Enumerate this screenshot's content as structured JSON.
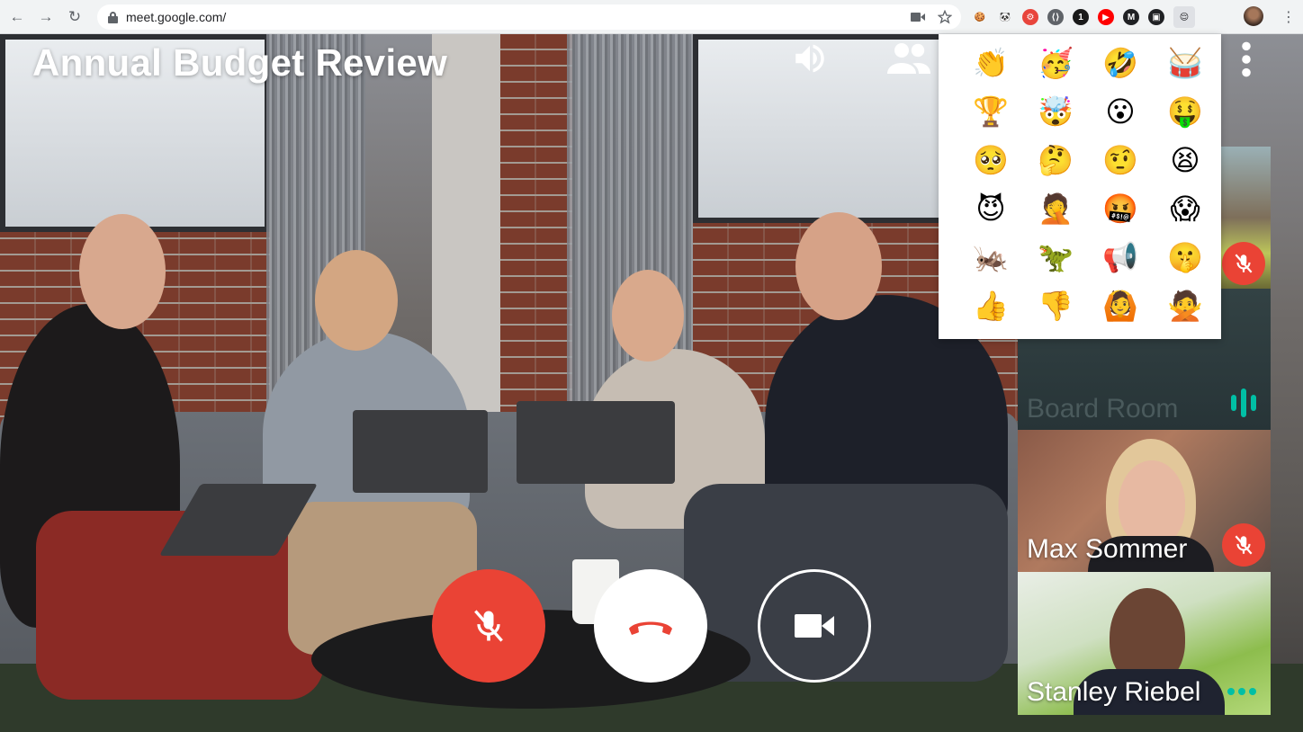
{
  "browser": {
    "url": "meet.google.com/",
    "nav": {
      "back": "←",
      "forward": "→",
      "reload": "↻"
    },
    "extensions": [
      {
        "icon": "cookie-icon",
        "glyph": "🍪",
        "color": "#f1f3f4"
      },
      {
        "icon": "panda-icon",
        "glyph": "🐼",
        "color": "#f1f3f4"
      },
      {
        "icon": "nodes-icon",
        "glyph": "⚙",
        "color": "#e8453c"
      },
      {
        "icon": "code-brackets-icon",
        "glyph": "⟨⟩",
        "color": "#5f6368"
      },
      {
        "icon": "onepassword-icon",
        "glyph": "1",
        "color": "#1a1a1a"
      },
      {
        "icon": "youtube-icon",
        "glyph": "▶",
        "color": "#ff0000"
      },
      {
        "icon": "m-icon",
        "glyph": "M",
        "color": "#202124"
      },
      {
        "icon": "dark-square-icon",
        "glyph": "▣",
        "color": "#202124"
      },
      {
        "icon": "emoji-extension-icon",
        "glyph": "😌",
        "color": "#dfe1e5"
      }
    ]
  },
  "meeting": {
    "title": "Annual Budget Review"
  },
  "emoji_picker": {
    "emojis": [
      {
        "glyph": "👏",
        "name": "clap"
      },
      {
        "glyph": "🥳",
        "name": "party-face"
      },
      {
        "glyph": "🤣",
        "name": "rofl"
      },
      {
        "glyph": "🥁",
        "name": "drum"
      },
      {
        "glyph": "🏆",
        "name": "trophy"
      },
      {
        "glyph": "🤯",
        "name": "mind-blown"
      },
      {
        "glyph": "😮",
        "name": "surprised"
      },
      {
        "glyph": "🤑",
        "name": "money-face"
      },
      {
        "glyph": "🥺",
        "name": "pleading"
      },
      {
        "glyph": "🤔",
        "name": "thinking"
      },
      {
        "glyph": "🤨",
        "name": "raised-eyebrow"
      },
      {
        "glyph": "😫",
        "name": "tired"
      },
      {
        "glyph": "😈",
        "name": "devil"
      },
      {
        "glyph": "🤦",
        "name": "facepalm"
      },
      {
        "glyph": "🤬",
        "name": "cursing"
      },
      {
        "glyph": "😱",
        "name": "scream"
      },
      {
        "glyph": "🦗",
        "name": "cricket"
      },
      {
        "glyph": "🦖",
        "name": "t-rex"
      },
      {
        "glyph": "📢",
        "name": "loudspeaker"
      },
      {
        "glyph": "🤫",
        "name": "shush"
      },
      {
        "glyph": "👍",
        "name": "thumbs-up"
      },
      {
        "glyph": "👎",
        "name": "thumbs-down"
      },
      {
        "glyph": "🙆",
        "name": "ok-gesture"
      },
      {
        "glyph": "🙅",
        "name": "no-gesture"
      }
    ]
  },
  "participants": [
    {
      "name": "",
      "muted": true,
      "indicator": "mute"
    },
    {
      "name": "Board Room",
      "muted": false,
      "indicator": "audio-bars"
    },
    {
      "name": "Max Sommer",
      "muted": true,
      "indicator": "mute"
    },
    {
      "name": "Stanley Riebel",
      "muted": false,
      "indicator": "dots"
    }
  ],
  "colors": {
    "mute_red": "#ea4335",
    "active_teal": "#00bfa5",
    "hangup_red": "#ea4335"
  }
}
